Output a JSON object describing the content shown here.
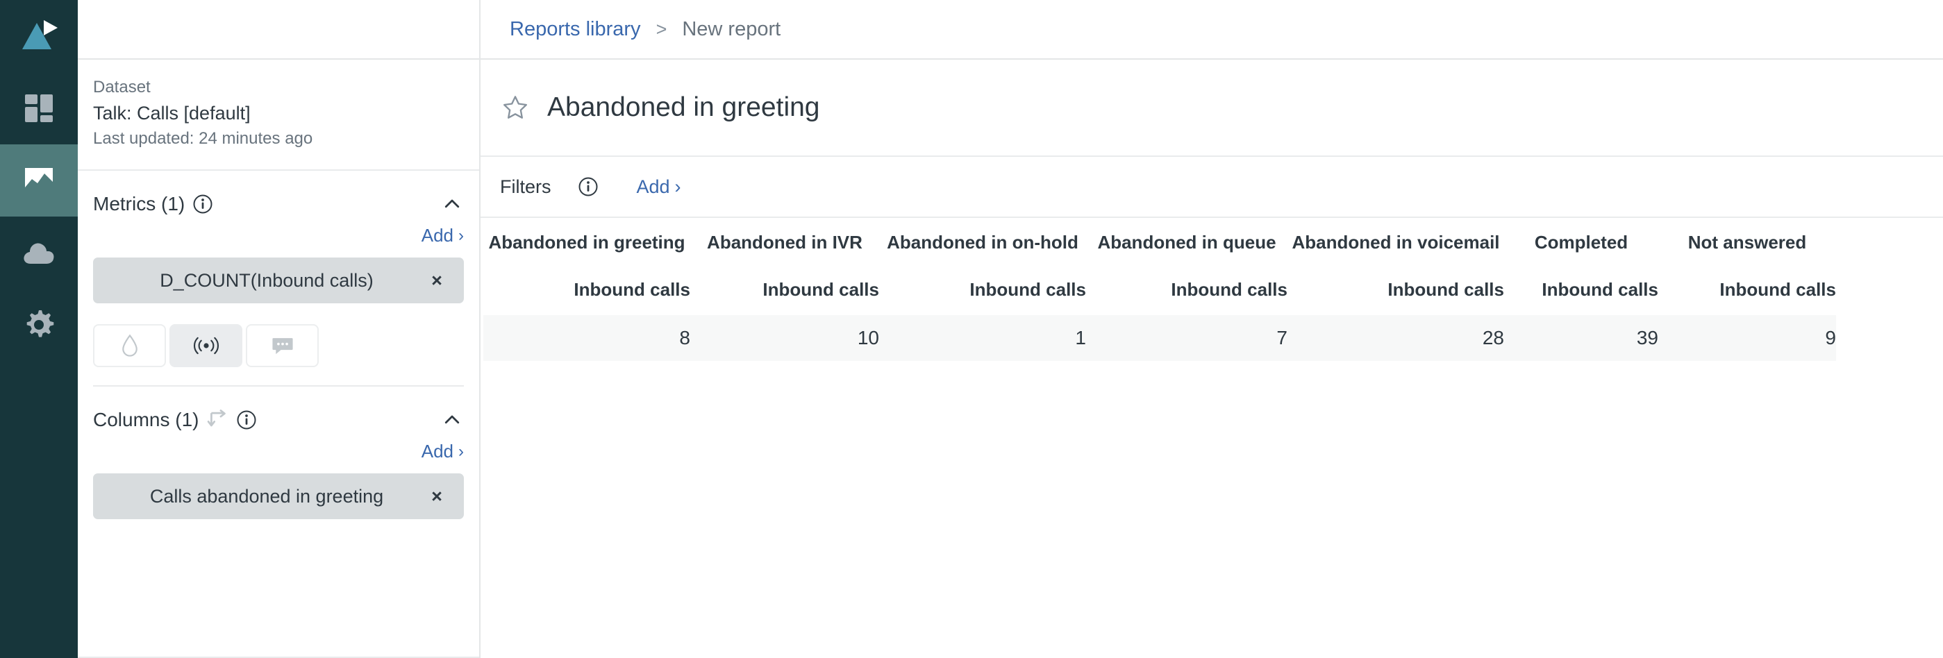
{
  "colors": {
    "rail_bg": "#17363b",
    "rail_active": "#4f7b7b",
    "logo_accent": "#4a9bb5",
    "link_blue": "#3a68ad",
    "text_dark": "#2f3941",
    "text_muted": "#68737d",
    "chip_bg": "#d8dcde",
    "row_bg": "#f7f8f8",
    "border": "#e4e6e7"
  },
  "rail": {
    "logo_name": "explore-logo-icon",
    "items": [
      {
        "name": "sidebar-item-dashboards",
        "icon": "dashboard-grid-icon",
        "active": false
      },
      {
        "name": "sidebar-item-reports",
        "icon": "chart-icon",
        "active": true
      },
      {
        "name": "sidebar-item-uploads",
        "icon": "cloud-upload-icon",
        "active": false
      },
      {
        "name": "sidebar-item-settings",
        "icon": "gear-icon",
        "active": false
      }
    ]
  },
  "breadcrumb": {
    "link_label": "Reports library",
    "separator": ">",
    "current_label": "New report"
  },
  "dataset": {
    "label": "Dataset",
    "name": "Talk: Calls [default]",
    "updated": "Last updated: 24 minutes ago"
  },
  "metrics": {
    "title": "Metrics (1)",
    "info_icon": "info-icon",
    "collapse_icon": "chevron-up-icon",
    "add_label": "Add",
    "add_caret": "›",
    "chips": [
      {
        "label": "D_COUNT(Inbound calls)",
        "remove_label": "×"
      }
    ],
    "toggles": [
      {
        "name": "toggle-drop",
        "icon": "droplet-icon",
        "selected": false
      },
      {
        "name": "toggle-signal",
        "icon": "broadcast-icon",
        "selected": true
      },
      {
        "name": "toggle-comment",
        "icon": "comment-dots-icon",
        "selected": false
      }
    ]
  },
  "columns": {
    "title": "Columns (1)",
    "swap_icon": "swap-rows-columns-icon",
    "info_icon": "info-icon",
    "collapse_icon": "chevron-up-icon",
    "add_label": "Add",
    "add_caret": "›",
    "chips": [
      {
        "label": "Calls abandoned in greeting",
        "remove_label": "×"
      }
    ]
  },
  "report": {
    "star_icon": "star-outline-icon",
    "title": "Abandoned in greeting"
  },
  "filters": {
    "label": "Filters",
    "info_icon": "info-icon",
    "add_label": "Add",
    "add_caret": "›"
  },
  "chart_data": {
    "type": "table",
    "title": "Abandoned in greeting",
    "categories": [
      "Abandoned in greeting",
      "Abandoned in IVR",
      "Abandoned in on-hold",
      "Abandoned in queue",
      "Abandoned in voicemail",
      "Completed",
      "Not answered"
    ],
    "subheaders": [
      "Inbound calls",
      "Inbound calls",
      "Inbound calls",
      "Inbound calls",
      "Inbound calls",
      "Inbound calls",
      "Inbound calls"
    ],
    "values": [
      8,
      10,
      1,
      7,
      28,
      39,
      9
    ],
    "series": [
      {
        "name": "Inbound calls",
        "values": [
          8,
          10,
          1,
          7,
          28,
          39,
          9
        ]
      }
    ],
    "xlabel": "",
    "ylabel": "Inbound calls",
    "legend": "none",
    "grid": false
  }
}
